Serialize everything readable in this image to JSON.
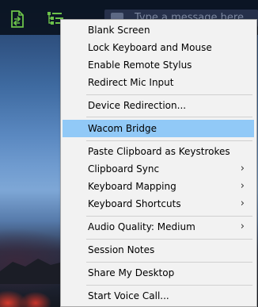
{
  "toolbar": {
    "message_placeholder": "Type a message here"
  },
  "menu": {
    "items": [
      {
        "label": "Blank Screen"
      },
      {
        "label": "Lock Keyboard and Mouse"
      },
      {
        "label": "Enable Remote Stylus"
      },
      {
        "label": "Redirect Mic Input"
      },
      {
        "label": "Device Redirection..."
      },
      {
        "label": "Wacom Bridge",
        "selected": true
      },
      {
        "label": "Paste Clipboard as Keystrokes"
      },
      {
        "label": "Clipboard Sync",
        "submenu": true
      },
      {
        "label": "Keyboard Mapping",
        "submenu": true
      },
      {
        "label": "Keyboard Shortcuts",
        "submenu": true
      },
      {
        "label": "Audio Quality: Medium",
        "submenu": true
      },
      {
        "label": "Session Notes"
      },
      {
        "label": "Share My Desktop"
      },
      {
        "label": "Start Voice Call..."
      }
    ],
    "submenu_arrow": "›"
  },
  "colors": {
    "highlight": "#91c9f7",
    "menu_bg": "#f2f2f2",
    "icon_green": "#6cc24a"
  }
}
